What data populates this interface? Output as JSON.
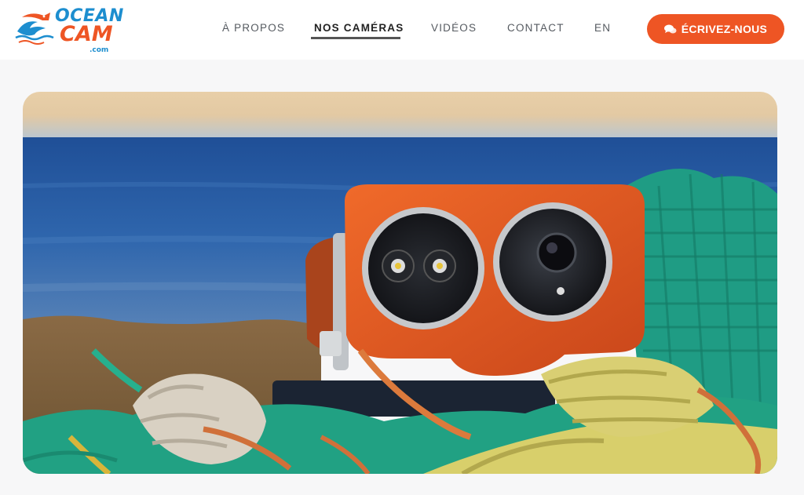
{
  "brand": {
    "line1": "OCEAN",
    "line2": "CAM",
    "suffix": ".com",
    "colors": {
      "blue": "#1d8ecf",
      "orange": "#ee5524"
    }
  },
  "nav": {
    "items": [
      {
        "label": "À PROPOS",
        "active": false
      },
      {
        "label": "NOS CAMÉRAS",
        "active": true
      },
      {
        "label": "VIDÉOS",
        "active": false
      },
      {
        "label": "CONTACT",
        "active": false
      },
      {
        "label": "EN",
        "active": false
      }
    ]
  },
  "cta": {
    "label": "ÉCRIVEZ-NOUS",
    "icon": "chat-bubbles-icon",
    "color": "#ee5524"
  },
  "hero": {
    "description_icon": "underwater-camera-on-fishing-nets-photo"
  }
}
